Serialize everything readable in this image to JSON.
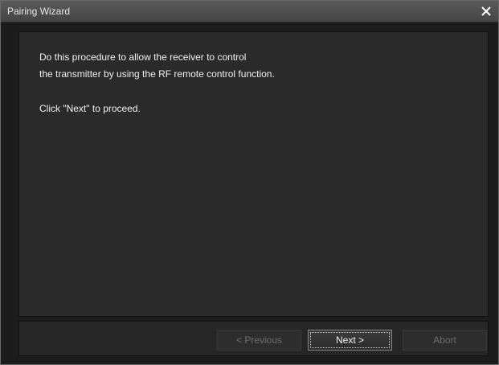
{
  "window": {
    "title": "Pairing Wizard",
    "close_icon": "close-icon"
  },
  "content": {
    "line1": "Do this procedure to allow the receiver to control",
    "line2": "the transmitter by using the RF remote control function.",
    "line3": "Click \"Next\" to proceed."
  },
  "buttons": {
    "previous": "< Previous",
    "next": "Next >",
    "abort": "Abort"
  },
  "colors": {
    "background": "#1c1c1c",
    "panel": "#2a2a2a",
    "text": "#f0f0f0",
    "disabled_text": "#6e6e6e"
  }
}
